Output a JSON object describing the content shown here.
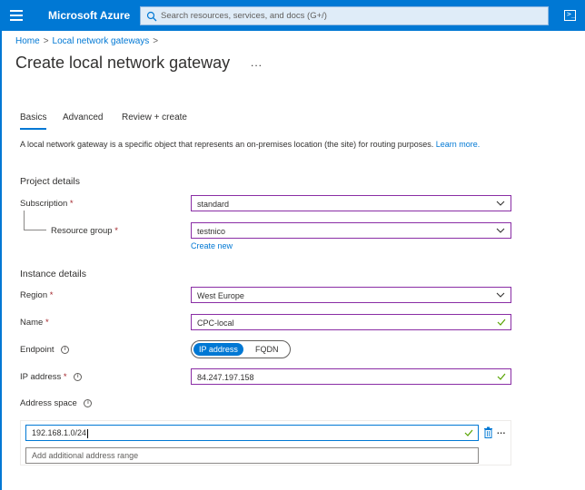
{
  "topbar": {
    "brand": "Microsoft Azure",
    "search_placeholder": "Search resources, services, and docs (G+/)",
    "menu_icon": "hamburger-icon",
    "search_icon": "search-icon",
    "cloudshell_icon": "cloud-shell-icon",
    "cloudshell_glyph": ">_"
  },
  "breadcrumb": {
    "items": [
      "Home",
      "Local network gateways"
    ],
    "separator": ">"
  },
  "page": {
    "title": "Create local network gateway",
    "more": "..."
  },
  "tabs": [
    {
      "label": "Basics",
      "active": true
    },
    {
      "label": "Advanced",
      "active": false
    },
    {
      "label": "Review + create",
      "active": false
    }
  ],
  "description": {
    "text": "A local network gateway is a specific object that represents an on-premises location (the site) for routing purposes.",
    "link": "Learn more."
  },
  "project_details": {
    "title": "Project details",
    "subscription": {
      "label": "Subscription",
      "required": "*",
      "value": "standard"
    },
    "resource_group": {
      "label": "Resource group",
      "required": "*",
      "value": "testnico"
    },
    "create_new": "Create new"
  },
  "instance_details": {
    "title": "Instance details",
    "region": {
      "label": "Region",
      "required": "*",
      "value": "West Europe"
    },
    "name": {
      "label": "Name",
      "required": "*",
      "value": "CPC-local"
    },
    "endpoint": {
      "label": "Endpoint",
      "options": [
        "IP address",
        "FQDN"
      ],
      "selected": "IP address"
    },
    "ip_address": {
      "label": "IP address",
      "required": "*",
      "value": "84.247.197.158"
    },
    "address_space": {
      "label": "Address space",
      "ranges": [
        "192.168.1.0/24"
      ],
      "add_placeholder": "Add additional address range"
    }
  },
  "colors": {
    "accent": "#0078d4",
    "invalid_border": "#8a2da5",
    "valid_check": "#57a300",
    "required": "#a4262c"
  }
}
